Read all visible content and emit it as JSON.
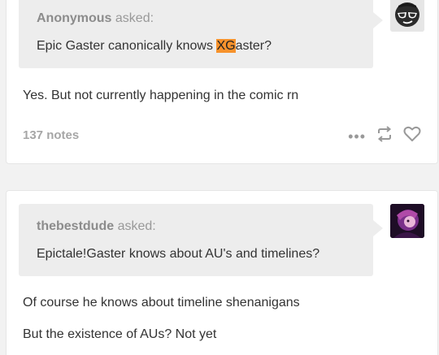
{
  "posts": [
    {
      "asker": "Anonymous",
      "asked_word": "asked:",
      "question_before": "Epic Gaster canonically knows ",
      "question_highlight": "XG",
      "question_after": "aster?",
      "answer": "Yes. But not currently happening in the comic rn",
      "notes": "137 notes",
      "avatar_icon": "sunglasses-face-icon"
    },
    {
      "asker": "thebestdude",
      "asked_word": "asked:",
      "question": "Epictale!Gaster knows about AU's and timelines?",
      "answer_paragraphs": [
        "Of course he knows about timeline shenanigans",
        "But the existence of AUs? Not yet"
      ],
      "avatar_icon": "character-portrait-icon"
    }
  ],
  "colors": {
    "highlight": "#f7922c",
    "ask_bg": "#ededed",
    "page_bg": "#f2f2f2"
  }
}
